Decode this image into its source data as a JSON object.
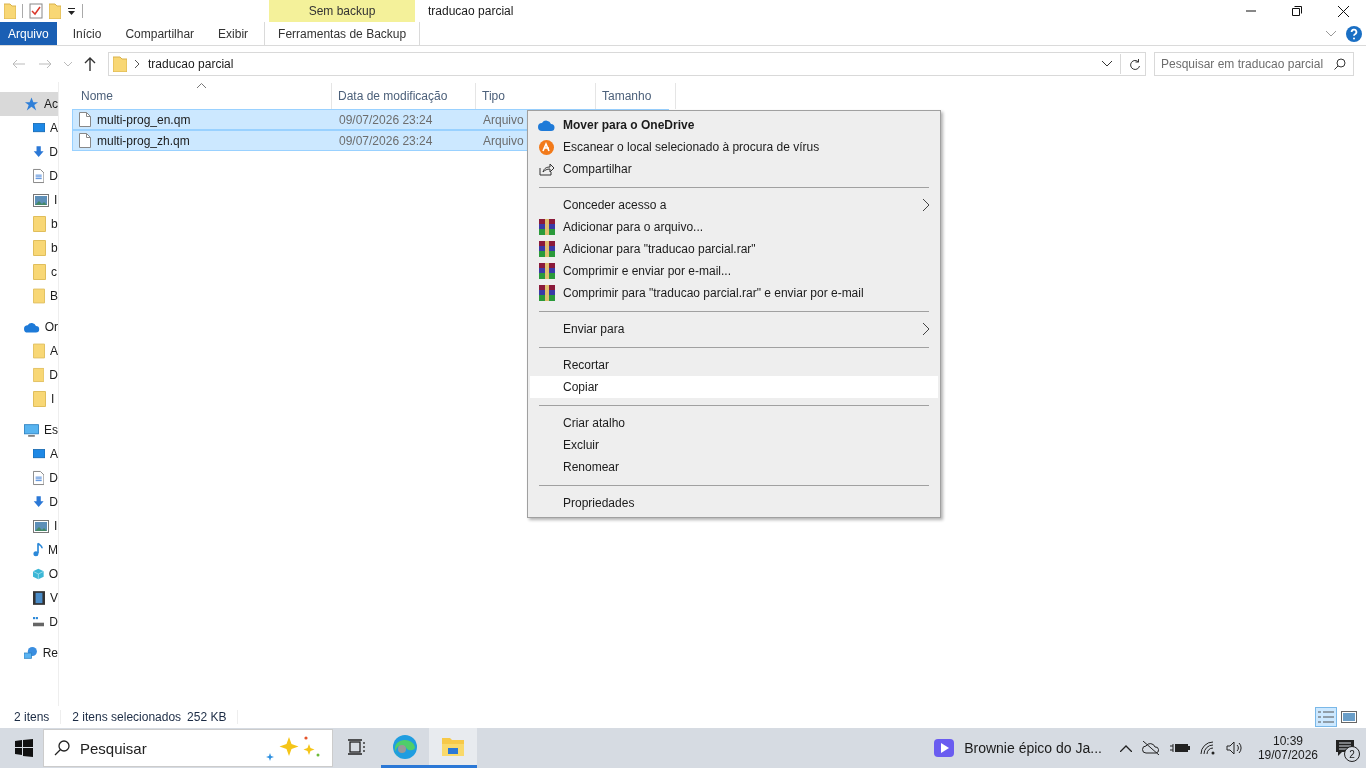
{
  "window": {
    "title": "traducao parcial"
  },
  "ribbon": {
    "context_group": "Sem backup",
    "tabs": [
      {
        "label": "Arquivo",
        "kind": "file"
      },
      {
        "label": "Início",
        "kind": "tab"
      },
      {
        "label": "Compartilhar",
        "kind": "tab"
      },
      {
        "label": "Exibir",
        "kind": "tab"
      },
      {
        "label": "Ferramentas de Backup",
        "kind": "context"
      }
    ]
  },
  "address_bar": {
    "path": "traducao parcial"
  },
  "search": {
    "placeholder": "Pesquisar em traducao parcial"
  },
  "sidebar": {
    "items": [
      {
        "label": "Ac",
        "kind": "star",
        "selected": true,
        "children": [
          {
            "label": "A",
            "kind": "desktop",
            "selected": false
          },
          {
            "label": "D",
            "kind": "download",
            "selected": false
          },
          {
            "label": "D",
            "kind": "document",
            "selected": false
          },
          {
            "label": "I",
            "kind": "image",
            "selected": false
          },
          {
            "label": "b",
            "kind": "folder",
            "selected": false
          },
          {
            "label": "b",
            "kind": "folder",
            "selected": false
          },
          {
            "label": "c",
            "kind": "folder",
            "selected": false
          },
          {
            "label": "B",
            "kind": "folder",
            "selected": false
          }
        ]
      },
      {
        "label": "Or",
        "kind": "cloud",
        "selected": false,
        "children": [
          {
            "label": "A",
            "kind": "folder",
            "selected": false
          },
          {
            "label": "D",
            "kind": "folder",
            "selected": false
          },
          {
            "label": "I",
            "kind": "folder",
            "selected": false
          }
        ]
      },
      {
        "label": "Es",
        "kind": "computer",
        "selected": false,
        "children": [
          {
            "label": "A",
            "kind": "desktop",
            "selected": false
          },
          {
            "label": "D",
            "kind": "document",
            "selected": false
          },
          {
            "label": "D",
            "kind": "download",
            "selected": false
          },
          {
            "label": "I",
            "kind": "image",
            "selected": false
          },
          {
            "label": "M",
            "kind": "music",
            "selected": false
          },
          {
            "label": "O",
            "kind": "cube",
            "selected": false
          },
          {
            "label": "V",
            "kind": "video",
            "selected": false
          },
          {
            "label": "D",
            "kind": "drive",
            "selected": false
          }
        ]
      },
      {
        "label": "Re",
        "kind": "network",
        "selected": false
      }
    ]
  },
  "file_list": {
    "columns": [
      "Nome",
      "Data de modificação",
      "Tipo",
      "Tamanho"
    ],
    "rows": [
      {
        "name": "multi-prog_en.qm",
        "modified": "09/07/2026 23:24",
        "type": "Arquivo",
        "selected": true
      },
      {
        "name": "multi-prog_zh.qm",
        "modified": "09/07/2026 23:24",
        "type": "Arquivo",
        "selected": true
      }
    ]
  },
  "context_menu": {
    "items": [
      {
        "kind": "cloud",
        "label": "Mover para o OneDrive",
        "bold": true,
        "submenu": false,
        "selected": false
      },
      {
        "kind": "antivirus",
        "label": "Escanear o local selecionado à procura de vírus",
        "bold": false,
        "submenu": false,
        "selected": false
      },
      {
        "kind": "share",
        "label": "Compartilhar",
        "bold": false,
        "submenu": false,
        "selected": false
      },
      {
        "kind": "separator"
      },
      {
        "kind": "plain",
        "label": "Conceder acesso a",
        "bold": false,
        "submenu": true,
        "selected": false
      },
      {
        "kind": "archive",
        "label": "Adicionar para o arquivo...",
        "bold": false,
        "submenu": false,
        "selected": false
      },
      {
        "kind": "archive",
        "label": "Adicionar para \"traducao parcial.rar\"",
        "bold": false,
        "submenu": false,
        "selected": false
      },
      {
        "kind": "archive",
        "label": "Comprimir e enviar por e-mail...",
        "bold": false,
        "submenu": false,
        "selected": false
      },
      {
        "kind": "archive",
        "label": "Comprimir para \"traducao parcial.rar\" e enviar por e-mail",
        "bold": false,
        "submenu": false,
        "selected": false
      },
      {
        "kind": "separator"
      },
      {
        "kind": "plain",
        "label": "Enviar para",
        "bold": false,
        "submenu": true,
        "selected": false
      },
      {
        "kind": "separator"
      },
      {
        "kind": "plain",
        "label": "Recortar",
        "bold": false,
        "submenu": false,
        "selected": false
      },
      {
        "kind": "plain",
        "label": "Copiar",
        "bold": false,
        "submenu": false,
        "selected": true
      },
      {
        "kind": "separator"
      },
      {
        "kind": "plain",
        "label": "Criar atalho",
        "bold": false,
        "submenu": false,
        "selected": false
      },
      {
        "kind": "plain",
        "label": "Excluir",
        "bold": false,
        "submenu": false,
        "selected": false
      },
      {
        "kind": "plain",
        "label": "Renomear",
        "bold": false,
        "submenu": false,
        "selected": false
      },
      {
        "kind": "separator"
      },
      {
        "kind": "plain",
        "label": "Propriedades",
        "bold": false,
        "submenu": false,
        "selected": false
      }
    ]
  },
  "status_bar": {
    "item_count": "2 itens",
    "selection": "2 itens selecionados",
    "selection_size": "252 KB",
    "views": [
      {
        "kind": "details",
        "selected": true
      },
      {
        "kind": "thumbnails",
        "selected": false
      }
    ]
  },
  "taskbar": {
    "search_placeholder": "Pesquisar",
    "apps": [
      {
        "kind": "taskview",
        "active": false
      },
      {
        "kind": "edge",
        "active": true
      },
      {
        "kind": "explorer",
        "active": true
      }
    ],
    "media_title": "Brownie épico do Ja...",
    "time": "10:39",
    "date": "19/07/2026",
    "notifications": "2"
  }
}
